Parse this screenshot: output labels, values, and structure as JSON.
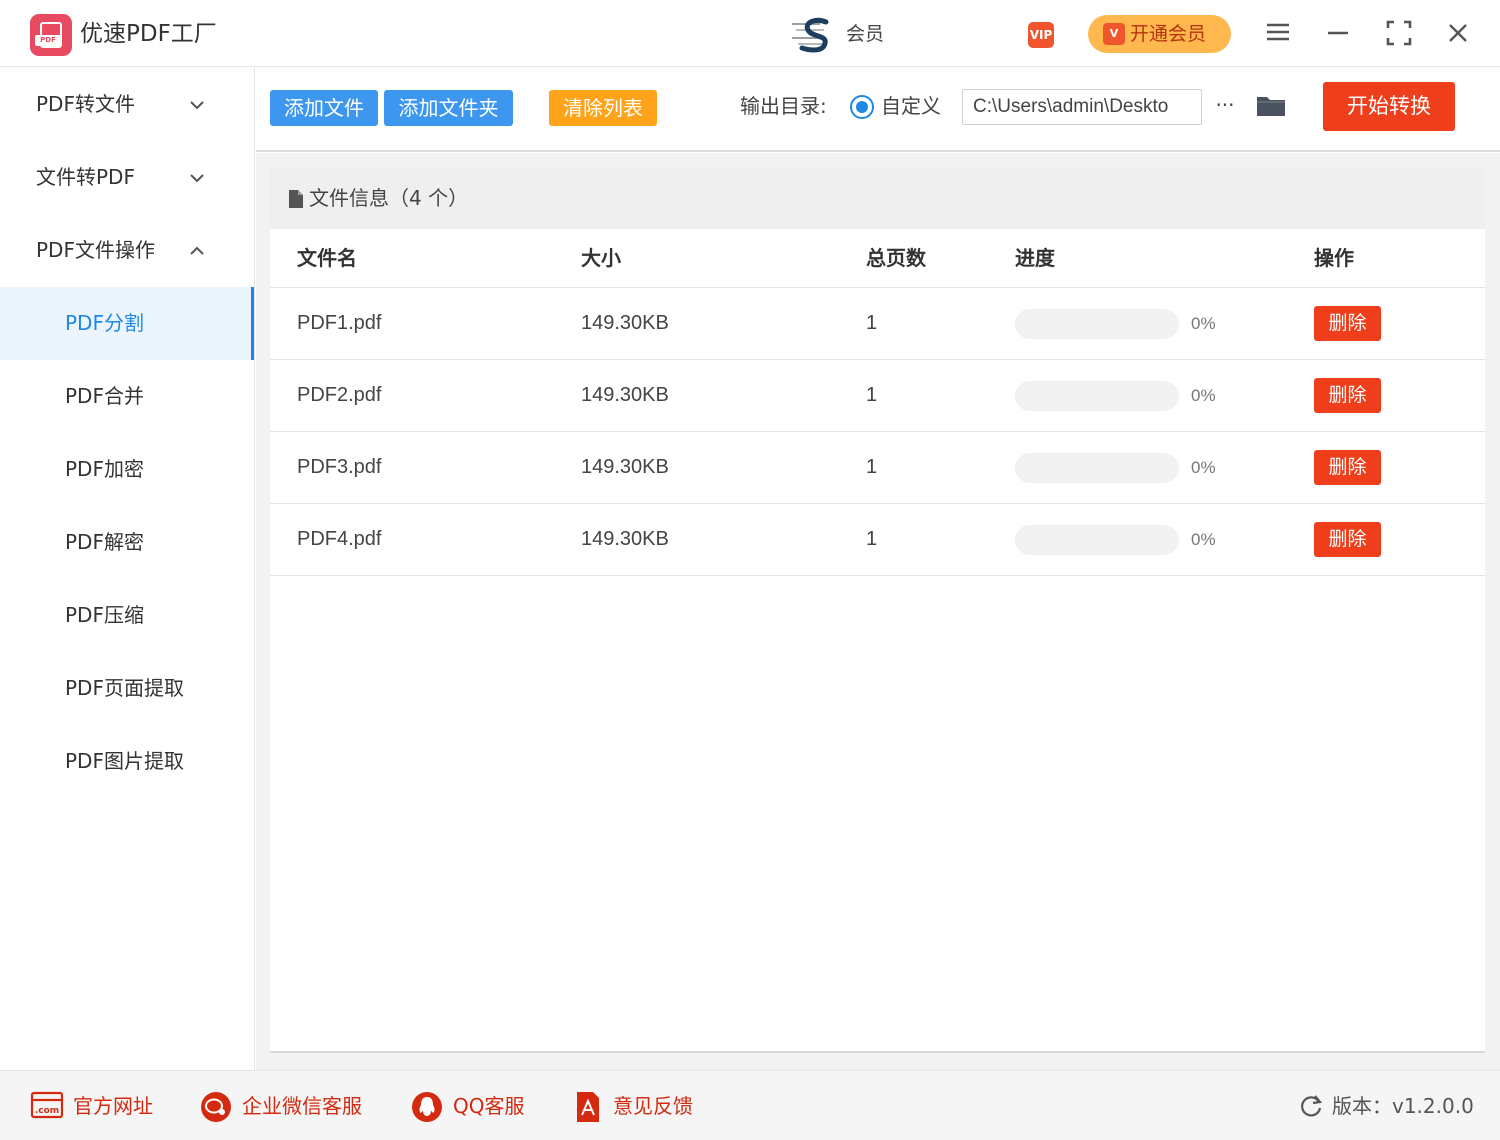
{
  "app": {
    "title": "优速PDF工厂",
    "logo_text": "PDF"
  },
  "user": {
    "name": "会员",
    "vip_badge": "VIP",
    "upgrade_label": "开通会员",
    "upgrade_icon": "V"
  },
  "sidebar": {
    "groups": [
      {
        "label": "PDF转文件",
        "expanded": false
      },
      {
        "label": "文件转PDF",
        "expanded": false
      },
      {
        "label": "PDF文件操作",
        "expanded": true
      }
    ],
    "items": [
      {
        "label": "PDF分割",
        "active": true
      },
      {
        "label": "PDF合并"
      },
      {
        "label": "PDF加密"
      },
      {
        "label": "PDF解密"
      },
      {
        "label": "PDF压缩"
      },
      {
        "label": "PDF页面提取"
      },
      {
        "label": "PDF图片提取"
      }
    ]
  },
  "toolbar": {
    "add_file": "添加文件",
    "add_folder": "添加文件夹",
    "clear_list": "清除列表",
    "output_label": "输出目录:",
    "radio_label": "自定义",
    "path_value": "C:\\Users\\admin\\Deskto",
    "more_label": "···",
    "start": "开始转换"
  },
  "panel": {
    "title": "文件信息（4 个）",
    "columns": {
      "name": "文件名",
      "size": "大小",
      "pages": "总页数",
      "progress": "进度",
      "op": "操作"
    },
    "rows": [
      {
        "name": "PDF1.pdf",
        "size": "149.30KB",
        "pages": "1",
        "progress": 0,
        "progress_text": "0%",
        "op": "删除"
      },
      {
        "name": "PDF2.pdf",
        "size": "149.30KB",
        "pages": "1",
        "progress": 0,
        "progress_text": "0%",
        "op": "删除"
      },
      {
        "name": "PDF3.pdf",
        "size": "149.30KB",
        "pages": "1",
        "progress": 0,
        "progress_text": "0%",
        "op": "删除"
      },
      {
        "name": "PDF4.pdf",
        "size": "149.30KB",
        "pages": "1",
        "progress": 0,
        "progress_text": "0%",
        "op": "删除"
      }
    ]
  },
  "footer": {
    "website": "官方网址",
    "website_icon_text": ".com",
    "wechat": "企业微信客服",
    "qq": "QQ客服",
    "feedback": "意见反馈",
    "version": "版本：v1.2.0.0"
  },
  "colors": {
    "primary_blue": "#3d97ef",
    "accent_blue": "#1e88e5",
    "orange": "#ffa31a",
    "red": "#ef3e1b",
    "vip_gold": "#ffb84d",
    "logo_pink": "#e84a5f"
  },
  "icons": [
    "app-logo-icon",
    "brand-s-icon",
    "vip-icon",
    "menu-icon",
    "minimize-icon",
    "maximize-icon",
    "close-icon",
    "chevron-down-icon",
    "chevron-up-icon",
    "file-icon",
    "folder-icon",
    "website-icon",
    "wechat-icon",
    "qq-icon",
    "feedback-icon",
    "refresh-icon"
  ]
}
